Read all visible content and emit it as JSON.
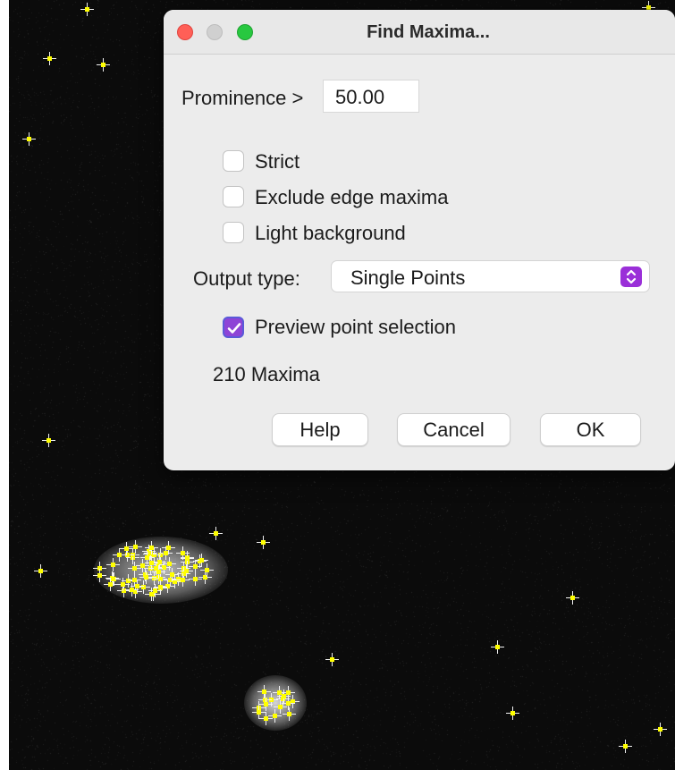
{
  "dialog": {
    "title": "Find Maxima...",
    "prominence_label": "Prominence >",
    "prominence_value": "50.00",
    "options": [
      {
        "label": "Strict",
        "checked": false
      },
      {
        "label": "Exclude edge maxima",
        "checked": false
      },
      {
        "label": "Light background",
        "checked": false
      }
    ],
    "output_type_label": "Output type:",
    "output_type_value": "Single Points",
    "preview": {
      "label": "Preview point selection",
      "checked": true
    },
    "maxima_count": "210 Maxima",
    "buttons": {
      "help": "Help",
      "cancel": "Cancel",
      "ok": "OK"
    }
  },
  "colors": {
    "image_background": "#0b0b0b",
    "marker": "#ffff00",
    "accent": "#9a2fd8",
    "dialog_background": "#ececec"
  }
}
